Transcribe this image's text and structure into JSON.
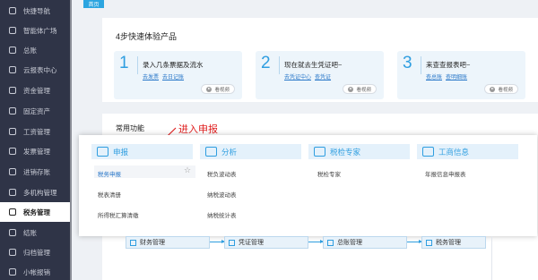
{
  "sidebar": {
    "items": [
      {
        "label": "快捷导航",
        "icon": "home-icon"
      },
      {
        "label": "智能体广场",
        "icon": "cloud-icon"
      },
      {
        "label": "总账",
        "icon": "book-icon"
      },
      {
        "label": "云报表中心",
        "icon": "chart-icon"
      },
      {
        "label": "资金管理",
        "icon": "wallet-icon"
      },
      {
        "label": "固定资产",
        "icon": "building-icon"
      },
      {
        "label": "工资管理",
        "icon": "document-icon"
      },
      {
        "label": "发票管理",
        "icon": "invoice-icon"
      },
      {
        "label": "进销存账",
        "icon": "box-icon"
      },
      {
        "label": "多机构管理",
        "icon": "org-icon"
      },
      {
        "label": "税务管理",
        "icon": "tax-icon"
      },
      {
        "label": "结账",
        "icon": "close-book-icon"
      },
      {
        "label": "归档管理",
        "icon": "archive-icon"
      },
      {
        "label": "小帐报销",
        "icon": "receipt-icon"
      }
    ],
    "active_label": "税务管理"
  },
  "top_tab": "首页",
  "quick": {
    "title": "4步快速体验产品",
    "steps": [
      {
        "num": "1",
        "title": "录入几条票据及流水",
        "links": [
          "去发票",
          "去日记账"
        ],
        "video": "看视频"
      },
      {
        "num": "2",
        "title": "现在就去生凭证吧~",
        "links": [
          "去凭证中心",
          "查凭证"
        ],
        "video": "看视频"
      },
      {
        "num": "3",
        "title": "来查查报表吧~",
        "links": [
          "查总账",
          "查明细账"
        ],
        "video": "看视频"
      }
    ]
  },
  "common": {
    "title": "常用功能"
  },
  "annotation": "进入申报",
  "menu": {
    "columns": [
      {
        "header": "申报",
        "icon": "declare-icon",
        "items": [
          "税务申报",
          "税表清册",
          "所得税汇算清缴"
        ]
      },
      {
        "header": "分析",
        "icon": "analysis-icon",
        "items": [
          "税负波动表",
          "纳税波动表",
          "纳税统计表"
        ]
      },
      {
        "header": "税检专家",
        "icon": "expert-icon",
        "items": [
          "税检专家"
        ]
      },
      {
        "header": "工商信息",
        "icon": "business-icon",
        "items": [
          "年报信息申报表"
        ]
      }
    ]
  },
  "flow": {
    "items": [
      "财务管理",
      "凭证管理",
      "总账管理",
      "税务管理"
    ]
  },
  "colors": {
    "sidebar_bg": "#2f3447",
    "accent": "#2f9ee0",
    "annotation": "#e02020"
  }
}
